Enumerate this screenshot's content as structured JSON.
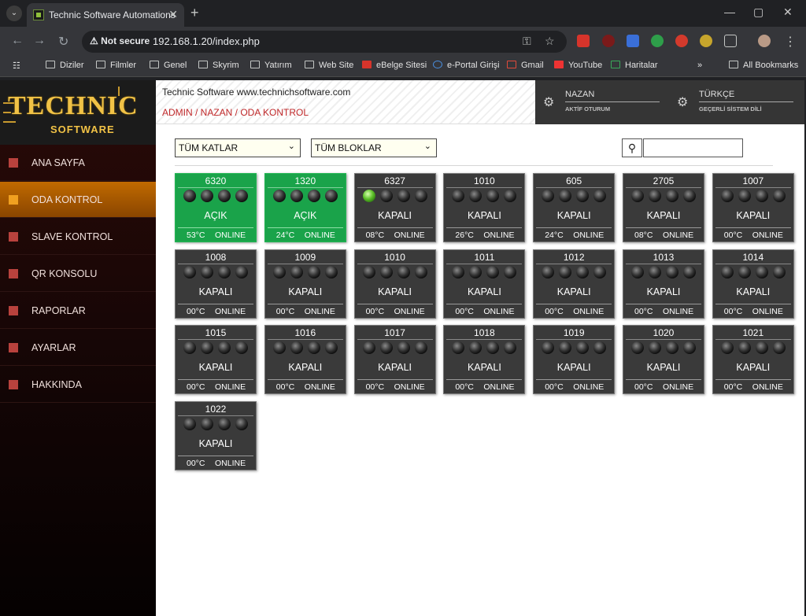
{
  "browser": {
    "tab_title": "Technic Software Automations",
    "not_secure": "Not secure",
    "url": "192.168.1.20/index.php",
    "bookmarks": [
      "Diziler",
      "Filmler",
      "Genel",
      "Skyrim",
      "Yatırım",
      "Web Site",
      "eBelge Sitesi",
      "e-Portal Girişi",
      "Gmail",
      "YouTube",
      "Haritalar"
    ],
    "all_bookmarks": "All Bookmarks"
  },
  "logo": {
    "main": "TECHNIC",
    "sub": "SOFTWARE"
  },
  "sidebar": {
    "items": [
      {
        "label": "ANA SAYFA",
        "active": false
      },
      {
        "label": "ODA KONTROL",
        "active": true
      },
      {
        "label": "SLAVE KONTROL",
        "active": false
      },
      {
        "label": "QR KONSOLU",
        "active": false
      },
      {
        "label": "RAPORLAR",
        "active": false
      },
      {
        "label": "AYARLAR",
        "active": false
      },
      {
        "label": "HAKKINDA",
        "active": false
      }
    ]
  },
  "header": {
    "site_title": "Technic Software www.technichsoftware.com",
    "breadcrumb": "ADMIN / NAZAN / ODA KONTROL",
    "user": {
      "name": "NAZAN",
      "sub": "AKTİF OTURUM"
    },
    "language": {
      "name": "TÜRKÇE",
      "sub": "GEÇERLİ SİSTEM DİLİ"
    }
  },
  "filters": {
    "floor": "TÜM KATLAR",
    "block": "TÜM BLOKLAR",
    "search_value": ""
  },
  "rooms": [
    {
      "no": "6320",
      "state": "AÇIK",
      "temp": "53°C",
      "status": "ONLINE",
      "open": true,
      "lamps": [
        false,
        false,
        false,
        false
      ]
    },
    {
      "no": "1320",
      "state": "AÇIK",
      "temp": "24°C",
      "status": "ONLINE",
      "open": true,
      "lamps": [
        false,
        false,
        false,
        false
      ]
    },
    {
      "no": "6327",
      "state": "KAPALI",
      "temp": "08°C",
      "status": "ONLINE",
      "open": false,
      "lamps": [
        true,
        false,
        false,
        false
      ]
    },
    {
      "no": "1010",
      "state": "KAPALI",
      "temp": "26°C",
      "status": "ONLINE",
      "open": false,
      "lamps": [
        false,
        false,
        false,
        false
      ]
    },
    {
      "no": "605",
      "state": "KAPALI",
      "temp": "24°C",
      "status": "ONLINE",
      "open": false,
      "lamps": [
        false,
        false,
        false,
        false
      ]
    },
    {
      "no": "2705",
      "state": "KAPALI",
      "temp": "08°C",
      "status": "ONLINE",
      "open": false,
      "lamps": [
        false,
        false,
        false,
        false
      ]
    },
    {
      "no": "1007",
      "state": "KAPALI",
      "temp": "00°C",
      "status": "ONLINE",
      "open": false,
      "lamps": [
        false,
        false,
        false,
        false
      ]
    },
    {
      "no": "1008",
      "state": "KAPALI",
      "temp": "00°C",
      "status": "ONLINE",
      "open": false,
      "lamps": [
        false,
        false,
        false,
        false
      ]
    },
    {
      "no": "1009",
      "state": "KAPALI",
      "temp": "00°C",
      "status": "ONLINE",
      "open": false,
      "lamps": [
        false,
        false,
        false,
        false
      ]
    },
    {
      "no": "1010",
      "state": "KAPALI",
      "temp": "00°C",
      "status": "ONLINE",
      "open": false,
      "lamps": [
        false,
        false,
        false,
        false
      ]
    },
    {
      "no": "1011",
      "state": "KAPALI",
      "temp": "00°C",
      "status": "ONLINE",
      "open": false,
      "lamps": [
        false,
        false,
        false,
        false
      ]
    },
    {
      "no": "1012",
      "state": "KAPALI",
      "temp": "00°C",
      "status": "ONLINE",
      "open": false,
      "lamps": [
        false,
        false,
        false,
        false
      ]
    },
    {
      "no": "1013",
      "state": "KAPALI",
      "temp": "00°C",
      "status": "ONLINE",
      "open": false,
      "lamps": [
        false,
        false,
        false,
        false
      ]
    },
    {
      "no": "1014",
      "state": "KAPALI",
      "temp": "00°C",
      "status": "ONLINE",
      "open": false,
      "lamps": [
        false,
        false,
        false,
        false
      ]
    },
    {
      "no": "1015",
      "state": "KAPALI",
      "temp": "00°C",
      "status": "ONLINE",
      "open": false,
      "lamps": [
        false,
        false,
        false,
        false
      ]
    },
    {
      "no": "1016",
      "state": "KAPALI",
      "temp": "00°C",
      "status": "ONLINE",
      "open": false,
      "lamps": [
        false,
        false,
        false,
        false
      ]
    },
    {
      "no": "1017",
      "state": "KAPALI",
      "temp": "00°C",
      "status": "ONLINE",
      "open": false,
      "lamps": [
        false,
        false,
        false,
        false
      ]
    },
    {
      "no": "1018",
      "state": "KAPALI",
      "temp": "00°C",
      "status": "ONLINE",
      "open": false,
      "lamps": [
        false,
        false,
        false,
        false
      ]
    },
    {
      "no": "1019",
      "state": "KAPALI",
      "temp": "00°C",
      "status": "ONLINE",
      "open": false,
      "lamps": [
        false,
        false,
        false,
        false
      ]
    },
    {
      "no": "1020",
      "state": "KAPALI",
      "temp": "00°C",
      "status": "ONLINE",
      "open": false,
      "lamps": [
        false,
        false,
        false,
        false
      ]
    },
    {
      "no": "1021",
      "state": "KAPALI",
      "temp": "00°C",
      "status": "ONLINE",
      "open": false,
      "lamps": [
        false,
        false,
        false,
        false
      ]
    },
    {
      "no": "1022",
      "state": "KAPALI",
      "temp": "00°C",
      "status": "ONLINE",
      "open": false,
      "lamps": [
        false,
        false,
        false,
        false
      ]
    }
  ]
}
